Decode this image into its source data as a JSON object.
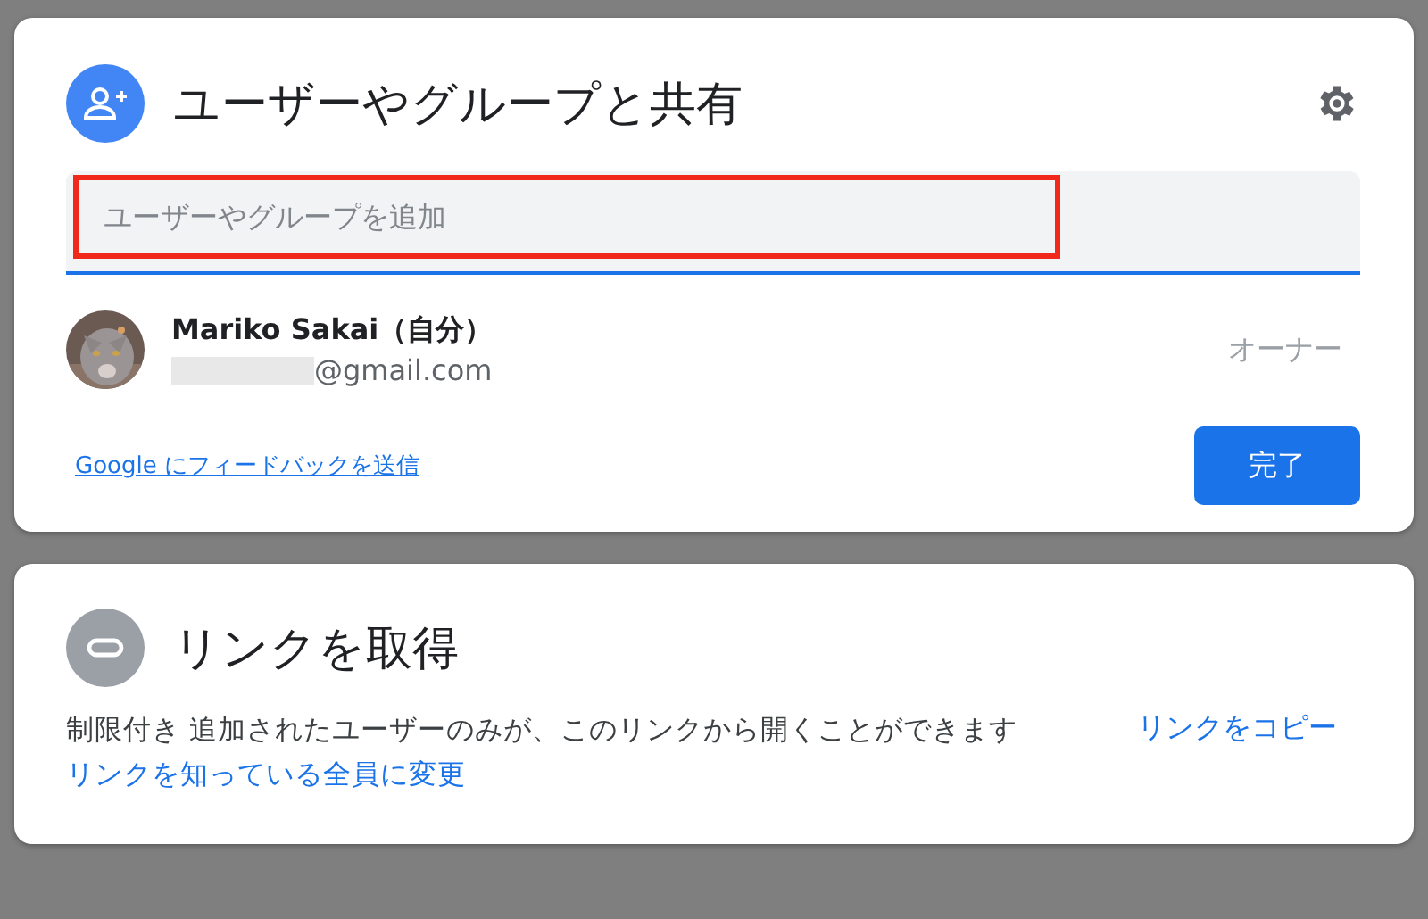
{
  "share_dialog": {
    "title": "ユーザーやグループと共有",
    "add_field": {
      "placeholder": "ユーザーやグループを追加",
      "highlighted": true
    },
    "people": [
      {
        "name": "Mariko Sakai（自分）",
        "email_redacted": true,
        "email": "@gmail.com",
        "role": "オーナー"
      }
    ],
    "feedback_link": "Google にフィードバックを送信",
    "done_button": "完了"
  },
  "link_panel": {
    "title": "リンクを取得",
    "description": "制限付き 追加されたユーザーのみが、このリンクから開くことができます",
    "change_link": "リンクを知っている全員に変更",
    "copy_link": "リンクをコピー"
  }
}
